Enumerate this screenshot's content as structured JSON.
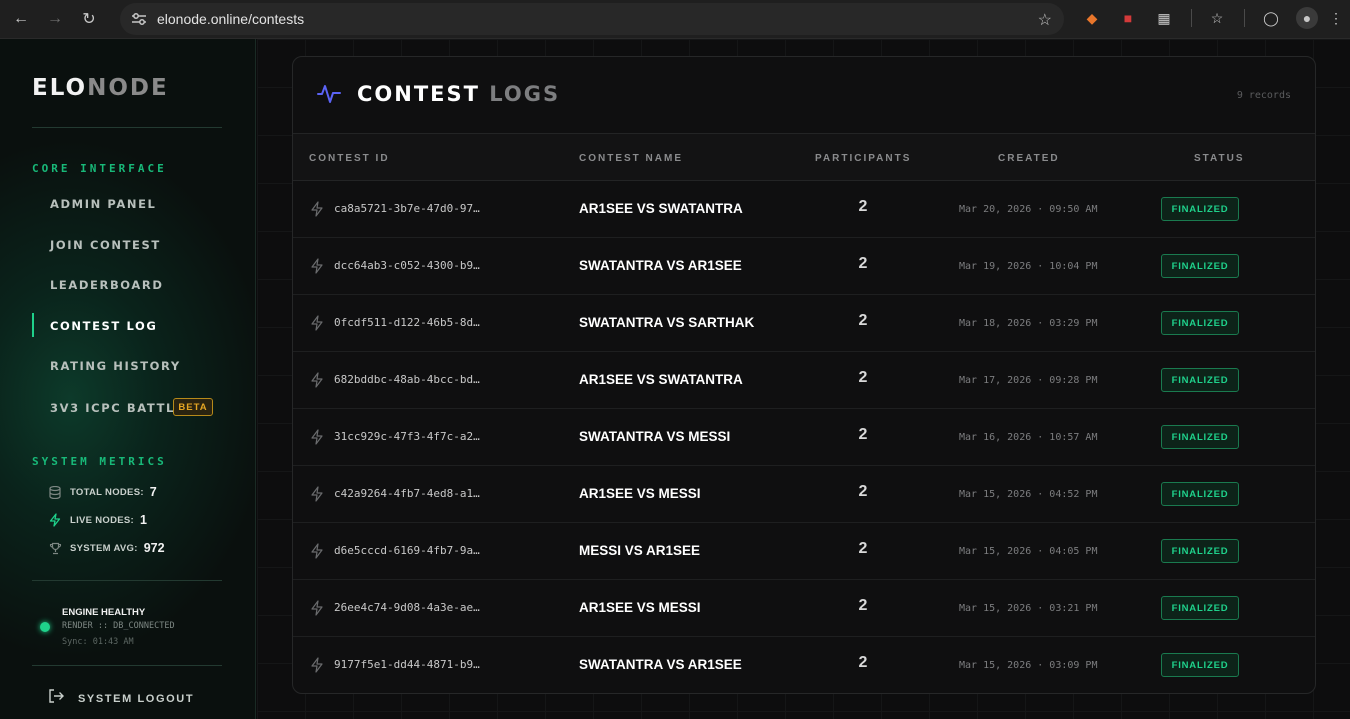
{
  "browser": {
    "url": "elonode.online/contests"
  },
  "sidebar": {
    "logo_primary": "ELO",
    "logo_secondary": "NODE",
    "core_title": "CORE INTERFACE",
    "nav": [
      {
        "label": "ADMIN PANEL",
        "active": false
      },
      {
        "label": "JOIN CONTEST",
        "active": false
      },
      {
        "label": "LEADERBOARD",
        "active": false
      },
      {
        "label": "CONTEST LOG",
        "active": true
      },
      {
        "label": "RATING HISTORY",
        "active": false
      },
      {
        "label": "3V3 ICPC BATTLE",
        "active": false,
        "badge": "BETA"
      }
    ],
    "metrics_title": "SYSTEM METRICS",
    "metrics": [
      {
        "icon": "database-icon",
        "label": "TOTAL NODES:",
        "value": "7"
      },
      {
        "icon": "bolt-icon",
        "label": "LIVE NODES:",
        "value": "1"
      },
      {
        "icon": "trophy-icon",
        "label": "SYSTEM AVG:",
        "value": "972"
      }
    ],
    "health": {
      "title": "ENGINE HEALTHY",
      "sub": "RENDER :: DB_CONNECTED",
      "sync": "Sync: 01:43 AM"
    },
    "logout_label": "SYSTEM LOGOUT"
  },
  "panel": {
    "title_primary": "CONTEST",
    "title_secondary": "LOGS",
    "records": "9 records",
    "columns": [
      "CONTEST ID",
      "CONTEST NAME",
      "PARTICIPANTS",
      "CREATED",
      "STATUS"
    ],
    "rows": [
      {
        "id": "ca8a5721-3b7e-47d0-97…",
        "name": "AR1SEE VS SWATANTRA",
        "participants": "2",
        "created": "Mar 20, 2026 · 09:50 AM",
        "status": "FINALIZED"
      },
      {
        "id": "dcc64ab3-c052-4300-b9…",
        "name": "SWATANTRA VS AR1SEE",
        "participants": "2",
        "created": "Mar 19, 2026 · 10:04 PM",
        "status": "FINALIZED"
      },
      {
        "id": "0fcdf511-d122-46b5-8d…",
        "name": "SWATANTRA VS SARTHAK",
        "participants": "2",
        "created": "Mar 18, 2026 · 03:29 PM",
        "status": "FINALIZED"
      },
      {
        "id": "682bddbc-48ab-4bcc-bd…",
        "name": "AR1SEE VS SWATANTRA",
        "participants": "2",
        "created": "Mar 17, 2026 · 09:28 PM",
        "status": "FINALIZED"
      },
      {
        "id": "31cc929c-47f3-4f7c-a2…",
        "name": "SWATANTRA VS MESSI",
        "participants": "2",
        "created": "Mar 16, 2026 · 10:57 AM",
        "status": "FINALIZED"
      },
      {
        "id": "c42a9264-4fb7-4ed8-a1…",
        "name": "AR1SEE VS MESSI",
        "participants": "2",
        "created": "Mar 15, 2026 · 04:52 PM",
        "status": "FINALIZED"
      },
      {
        "id": "d6e5cccd-6169-4fb7-9a…",
        "name": "MESSI VS AR1SEE",
        "participants": "2",
        "created": "Mar 15, 2026 · 04:05 PM",
        "status": "FINALIZED"
      },
      {
        "id": "26ee4c74-9d08-4a3e-ae…",
        "name": "AR1SEE VS MESSI",
        "participants": "2",
        "created": "Mar 15, 2026 · 03:21 PM",
        "status": "FINALIZED"
      },
      {
        "id": "9177f5e1-dd44-4871-b9…",
        "name": "SWATANTRA VS AR1SEE",
        "participants": "2",
        "created": "Mar 15, 2026 · 03:09 PM",
        "status": "FINALIZED"
      }
    ]
  },
  "colors": {
    "accent": "#1fd18b",
    "beta": "#e5a623",
    "title_pulse": "#5b63f5"
  }
}
